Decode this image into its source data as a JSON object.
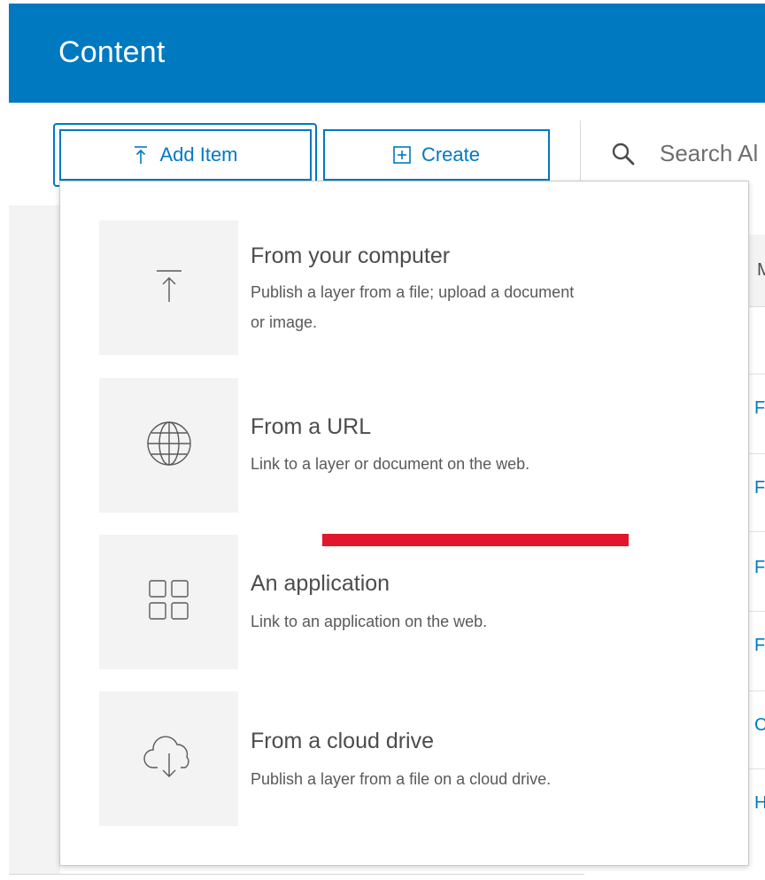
{
  "header": {
    "title": "Content"
  },
  "toolbar": {
    "add_item_label": "Add Item",
    "create_label": "Create"
  },
  "search": {
    "placeholder": "Search Al"
  },
  "table": {
    "header_partial": "M",
    "row_partials": [
      "F",
      "F",
      "F",
      "F",
      "C",
      "H"
    ]
  },
  "menu": {
    "items": [
      {
        "icon": "upload-icon",
        "title": "From your computer",
        "description_line1": "Publish a layer from a file; upload a document",
        "description_line2": "or image."
      },
      {
        "icon": "globe-icon",
        "title": "From a URL",
        "description_line1": "Link to a layer or document on the web.",
        "description_line2": ""
      },
      {
        "icon": "grid-apps-icon",
        "title": "An application",
        "description_line1": "Link to an application on the web.",
        "description_line2": ""
      },
      {
        "icon": "cloud-download-icon",
        "title": "From a cloud drive",
        "description_line1": "Publish a layer from a file on a cloud drive.",
        "description_line2": ""
      }
    ]
  },
  "colors": {
    "brand_blue": "#0079c1",
    "highlight_red": "#e3172b",
    "tile_gray": "#f3f3f3"
  }
}
